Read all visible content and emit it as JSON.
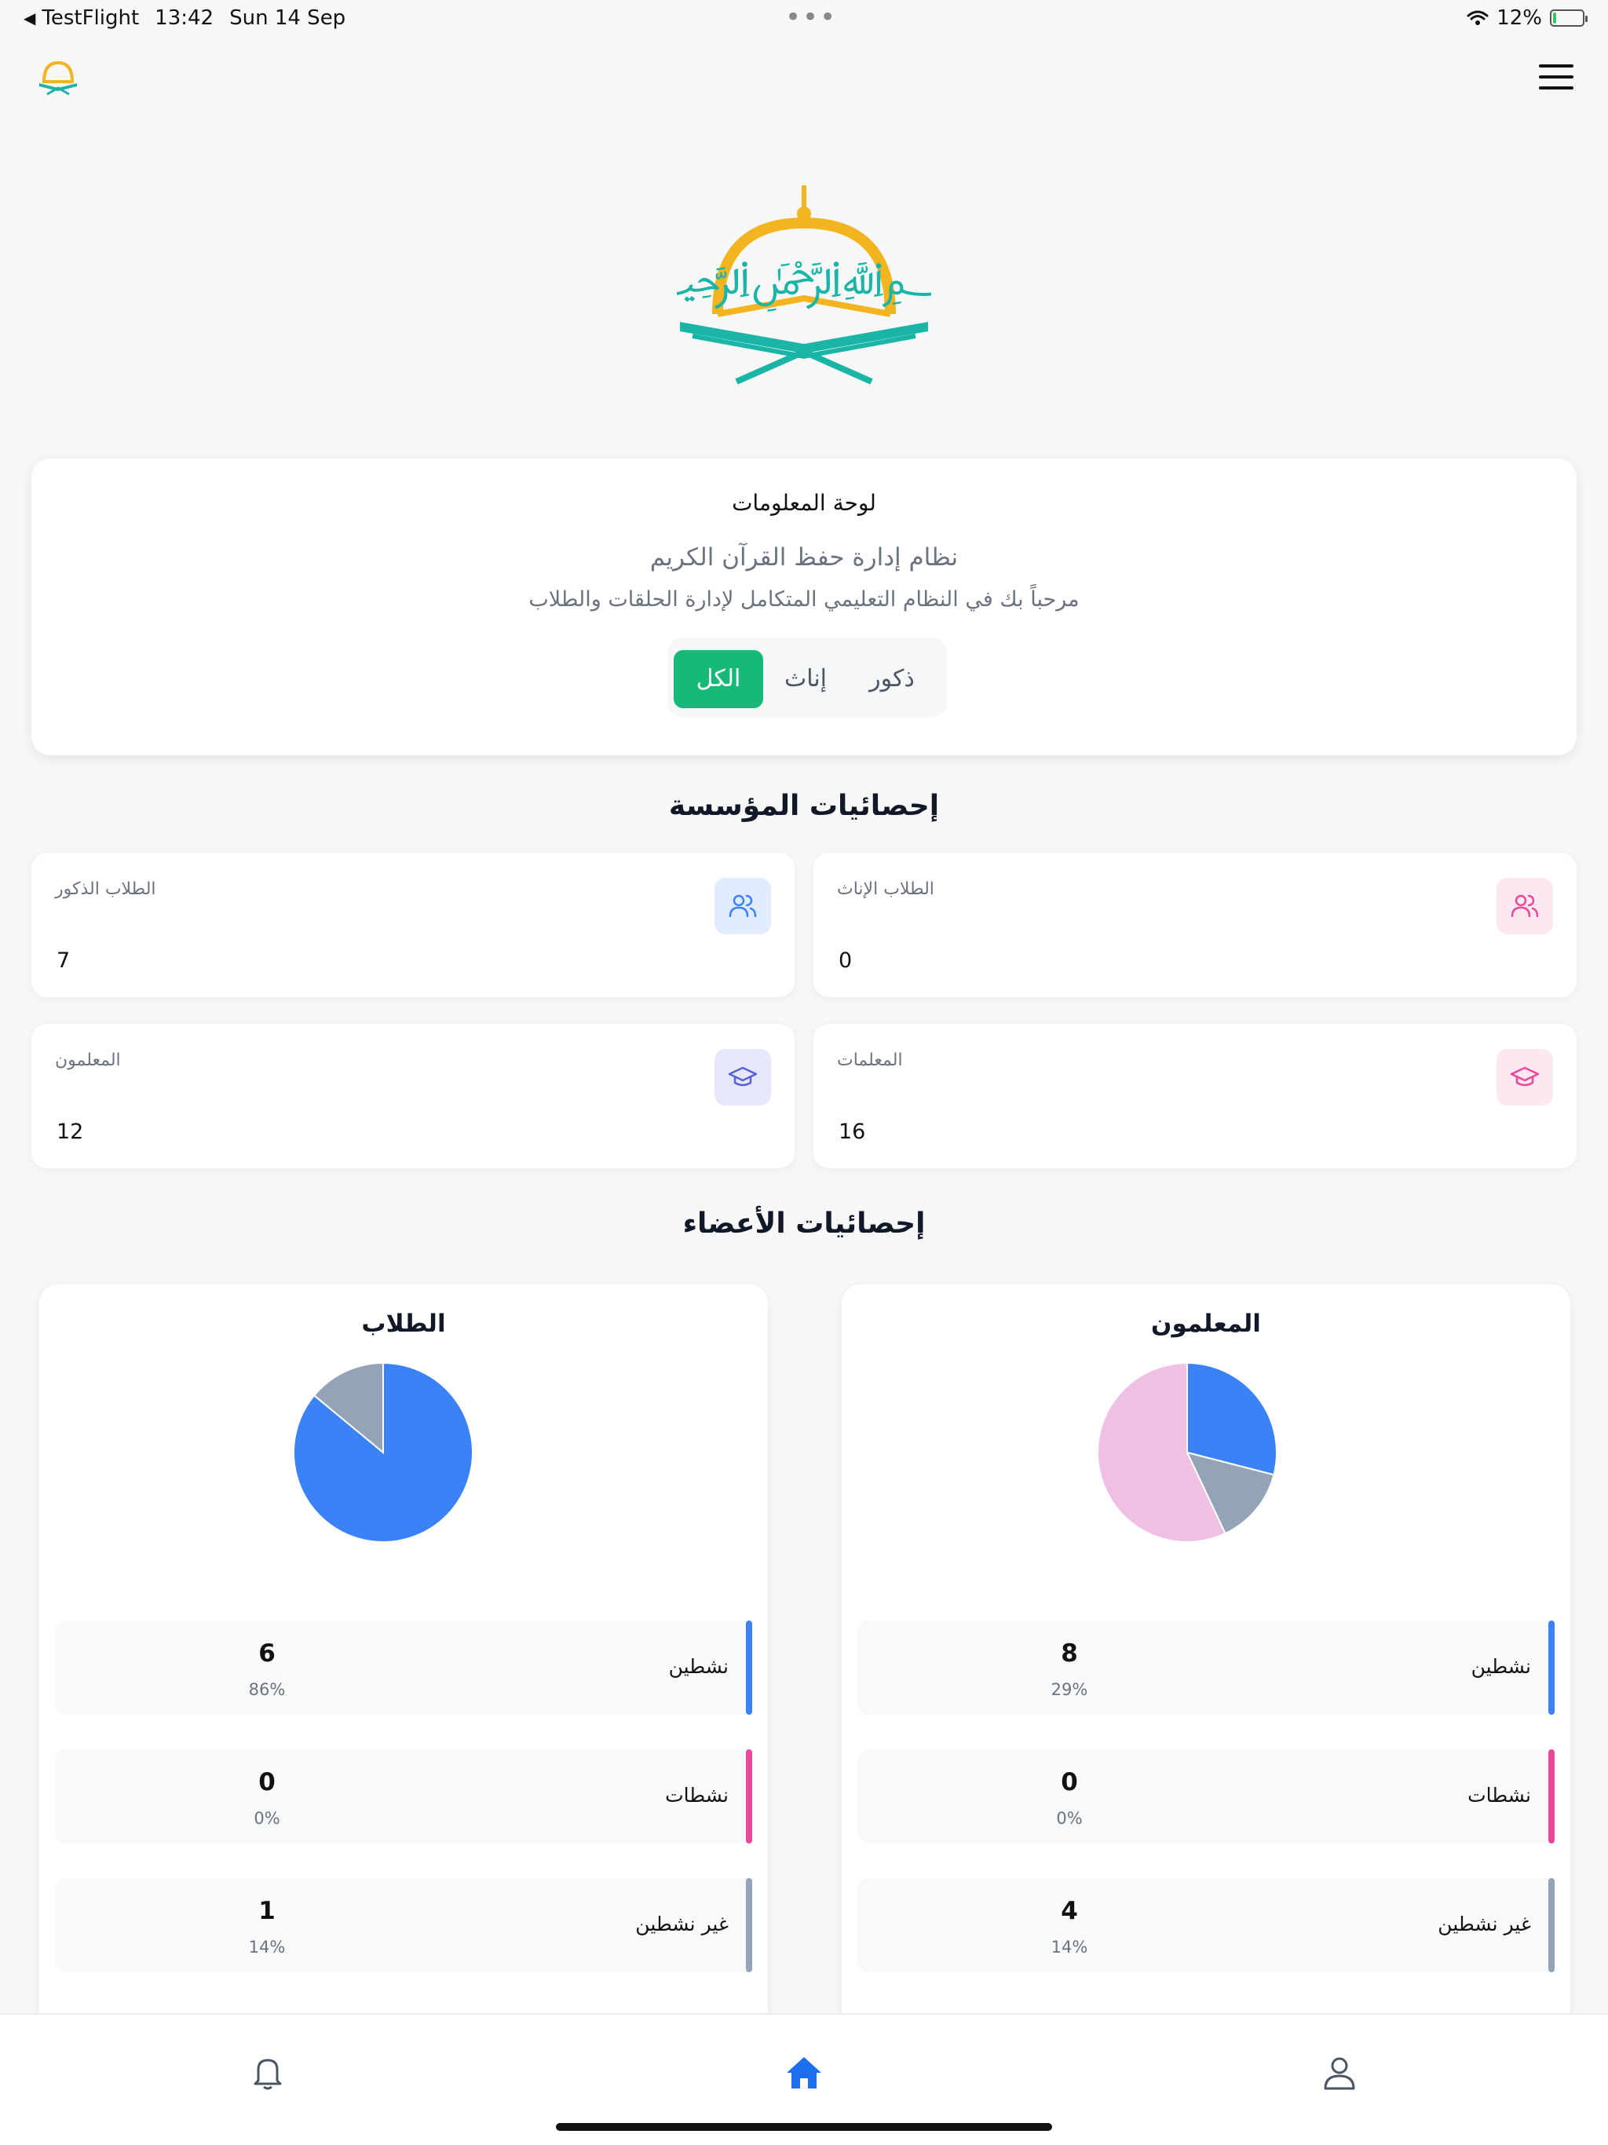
{
  "status_bar": {
    "back_glyph": "◀",
    "app": "TestFlight",
    "time": "13:42",
    "date": "Sun 14 Sep",
    "dots": "•••",
    "battery": "12%",
    "battery_level": 0.12
  },
  "info_card": {
    "title": "لوحة المعلومات",
    "subtitle": "نظام إدارة حفظ القرآن الكريم",
    "welcome": "مرحباً بك في النظام التعليمي المتكامل لإدارة الحلقات والطلاب",
    "filters": [
      {
        "label": "ذكور"
      },
      {
        "label": "إناث"
      },
      {
        "label": "الكل"
      }
    ],
    "active_filter": "الكل"
  },
  "sections": {
    "institution_stats": "إحصائيات المؤسسة",
    "member_stats": "إحصائيات الأعضاء"
  },
  "stats": {
    "female_students": {
      "label": "الطلاب الإناث",
      "value": "0"
    },
    "male_students": {
      "label": "الطلاب الذكور",
      "value": "7"
    },
    "female_teachers": {
      "label": "المعلمات",
      "value": "16"
    },
    "male_teachers": {
      "label": "المعلمون",
      "value": "12"
    }
  },
  "panels": {
    "teachers": {
      "title": "المعلمون",
      "rows": [
        {
          "label": "نشطين",
          "count": "8",
          "pct": "29%",
          "color": "#3b82f6"
        },
        {
          "label": "نشطات",
          "count": "0",
          "pct": "0%",
          "color": "#ec4899"
        },
        {
          "label": "غير نشطين",
          "count": "4",
          "pct": "14%",
          "color": "#94a3b8"
        }
      ],
      "pie": [
        {
          "value": 29,
          "color": "#3b82f6"
        },
        {
          "value": 14,
          "color": "#94a3b8"
        },
        {
          "value": 57,
          "color": "#f0c0e4"
        }
      ]
    },
    "students": {
      "title": "الطلاب",
      "rows": [
        {
          "label": "نشطين",
          "count": "6",
          "pct": "86%",
          "color": "#3b82f6"
        },
        {
          "label": "نشطات",
          "count": "0",
          "pct": "0%",
          "color": "#ec4899"
        },
        {
          "label": "غير نشطين",
          "count": "1",
          "pct": "14%",
          "color": "#94a3b8"
        }
      ],
      "pie": [
        {
          "value": 86,
          "color": "#3b82f6"
        },
        {
          "value": 14,
          "color": "#94a3b8"
        }
      ]
    }
  },
  "colors": {
    "accent_green": "#17b978",
    "blue": "#3b82f6",
    "pink": "#ec4899",
    "gray": "#94a3b8",
    "logo_gold": "#f2b51f",
    "logo_teal": "#1bb5a8"
  },
  "bottom_nav": {
    "icons": [
      "bell-icon",
      "home-icon",
      "user-icon"
    ],
    "active": "home-icon"
  }
}
